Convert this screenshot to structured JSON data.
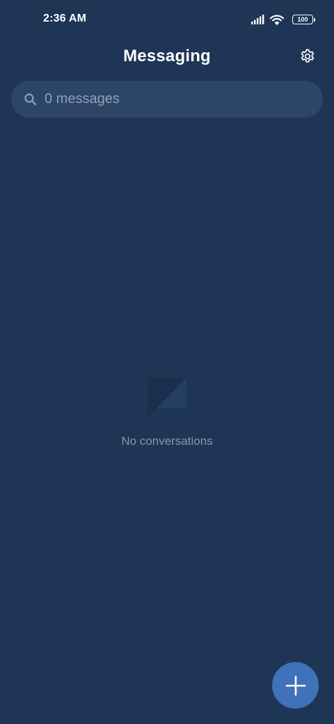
{
  "status_bar": {
    "time": "2:36 AM",
    "battery_level": "100",
    "icons": [
      "signal-icon",
      "wifi-icon",
      "battery-icon"
    ]
  },
  "header": {
    "title": "Messaging",
    "settings_icon": "gear-icon"
  },
  "search": {
    "placeholder": "0 messages",
    "icon": "search-icon"
  },
  "empty_state": {
    "icon": "chat-bubble-icon",
    "text": "No conversations"
  },
  "fab": {
    "icon": "plus-icon"
  },
  "colors": {
    "background": "#1f3556",
    "search_background": "#2d4566",
    "fab": "#3f72b8",
    "muted_text": "#8797ad"
  }
}
